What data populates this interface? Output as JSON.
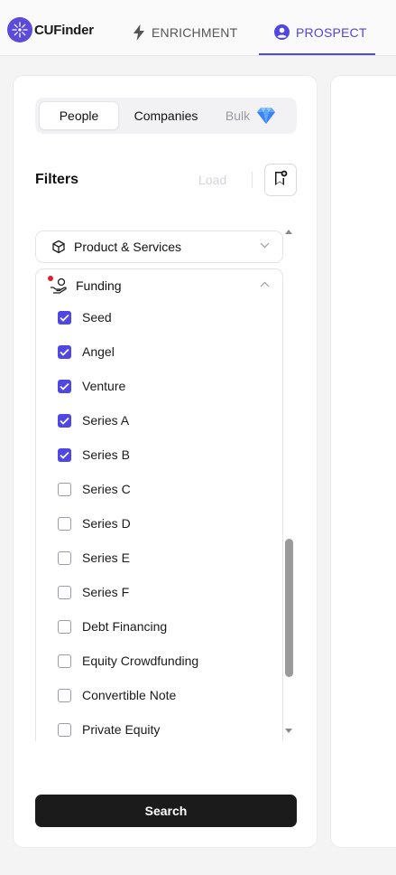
{
  "app": {
    "name": "CUFinder"
  },
  "nav": {
    "tabs": [
      {
        "label": "ENRICHMENT",
        "icon": "lightning-icon"
      },
      {
        "label": "PROSPECT",
        "icon": "user-circle-icon",
        "active": true
      }
    ]
  },
  "segment": {
    "people": "People",
    "companies": "Companies",
    "bulk": "Bulk",
    "selected": "People"
  },
  "filters": {
    "title": "Filters",
    "load_label": "Load",
    "sections": [
      {
        "label": "Product & Services",
        "icon": "cube-icon",
        "expanded": false
      },
      {
        "label": "Funding",
        "icon": "hand-coin-icon",
        "expanded": true,
        "has_active": true,
        "options": [
          {
            "label": "Seed",
            "checked": true
          },
          {
            "label": "Angel",
            "checked": true
          },
          {
            "label": "Venture",
            "checked": true
          },
          {
            "label": "Series A",
            "checked": true
          },
          {
            "label": "Series B",
            "checked": true
          },
          {
            "label": "Series C",
            "checked": false
          },
          {
            "label": "Series D",
            "checked": false
          },
          {
            "label": "Series E",
            "checked": false
          },
          {
            "label": "Series F",
            "checked": false
          },
          {
            "label": "Debt Financing",
            "checked": false
          },
          {
            "label": "Equity Crowdfunding",
            "checked": false
          },
          {
            "label": "Convertible Note",
            "checked": false
          },
          {
            "label": "Private Equity",
            "checked": false
          }
        ]
      }
    ]
  },
  "search": {
    "label": "Search"
  },
  "colors": {
    "accent": "#4f46e5",
    "dark_button": "#1b1b1b",
    "dot": "#e11d2e"
  }
}
